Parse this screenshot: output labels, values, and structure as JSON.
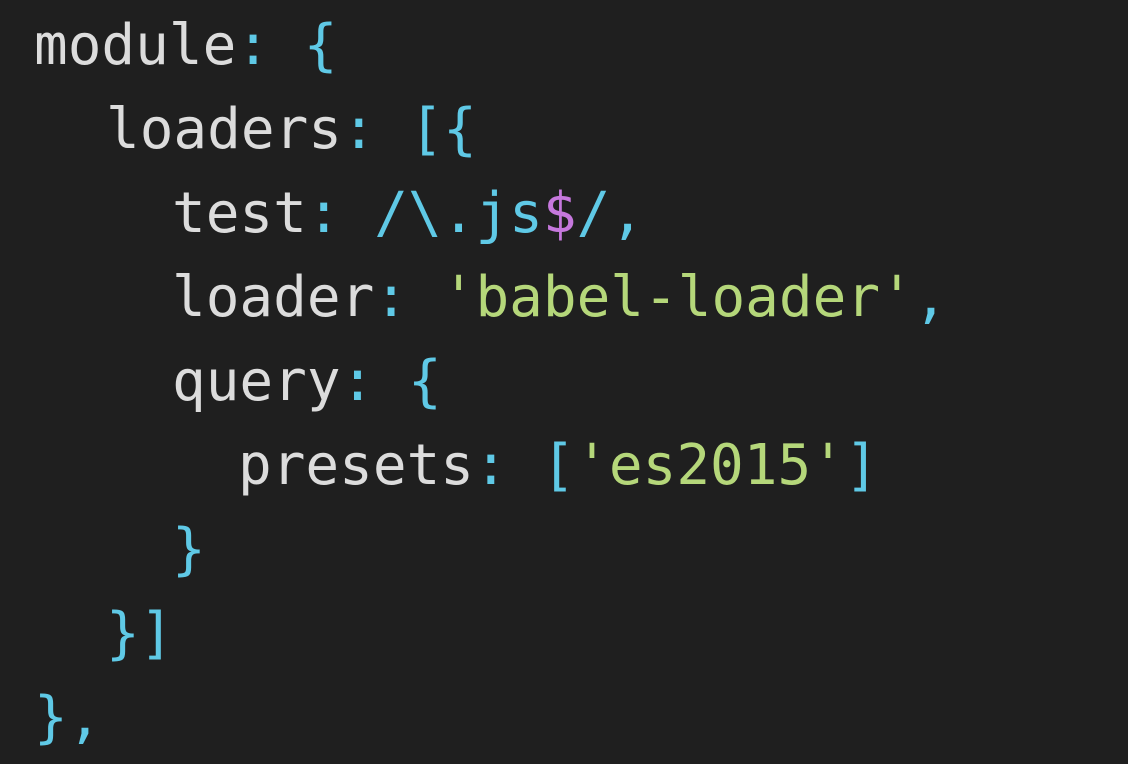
{
  "editor": {
    "lines": [
      {
        "indent": 0,
        "tokens": [
          {
            "t": "key",
            "v": "module"
          },
          {
            "t": "punct",
            "v": ": {"
          }
        ]
      },
      {
        "indent": 1,
        "tokens": [
          {
            "t": "key",
            "v": "loaders"
          },
          {
            "t": "punct",
            "v": ": [{"
          }
        ]
      },
      {
        "indent": 2,
        "tokens": [
          {
            "t": "key",
            "v": "test"
          },
          {
            "t": "punct",
            "v": ": "
          },
          {
            "t": "regex",
            "v": "/\\.js"
          },
          {
            "t": "special",
            "v": "$"
          },
          {
            "t": "regex",
            "v": "/"
          },
          {
            "t": "punct",
            "v": ","
          }
        ]
      },
      {
        "indent": 2,
        "tokens": [
          {
            "t": "key",
            "v": "loader"
          },
          {
            "t": "punct",
            "v": ": "
          },
          {
            "t": "str",
            "v": "'babel-loader'"
          },
          {
            "t": "punct",
            "v": ","
          }
        ]
      },
      {
        "indent": 2,
        "tokens": [
          {
            "t": "key",
            "v": "query"
          },
          {
            "t": "punct",
            "v": ": {"
          }
        ]
      },
      {
        "indent": 3,
        "tokens": [
          {
            "t": "key",
            "v": "presets"
          },
          {
            "t": "punct",
            "v": ": ["
          },
          {
            "t": "str",
            "v": "'es2015'"
          },
          {
            "t": "punct",
            "v": "]"
          }
        ]
      },
      {
        "indent": 2,
        "tokens": [
          {
            "t": "punct",
            "v": "}"
          }
        ]
      },
      {
        "indent": 1,
        "tokens": [
          {
            "t": "punct",
            "v": "}]"
          }
        ]
      },
      {
        "indent": 0,
        "tokens": [
          {
            "t": "punct",
            "v": "},"
          }
        ]
      }
    ]
  },
  "colors": {
    "background": "#1f1f1f",
    "key": "#dcdcdc",
    "punctuation": "#5fc9e6",
    "string": "#b5d77a",
    "special": "#c678dd"
  }
}
